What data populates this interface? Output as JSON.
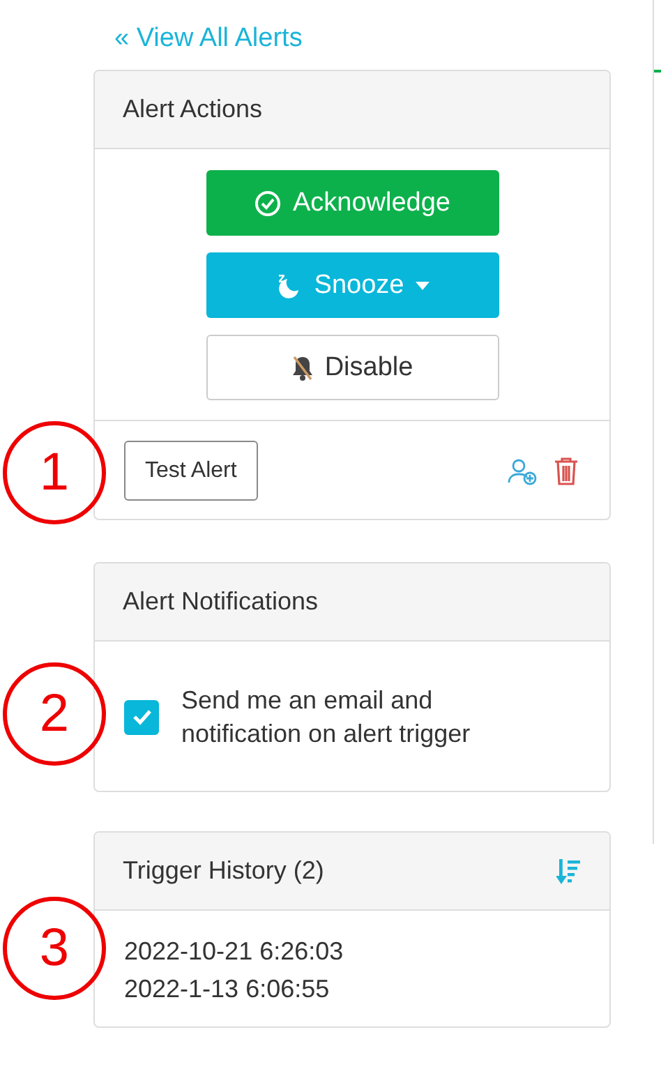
{
  "back_link": "« View All Alerts",
  "alert_actions": {
    "title": "Alert Actions",
    "buttons": [
      {
        "kind": "success",
        "label": "Acknowledge",
        "dropdown": false
      },
      {
        "kind": "info",
        "label": "Snooze",
        "dropdown": true
      },
      {
        "kind": "default",
        "label": "Disable",
        "dropdown": false
      }
    ],
    "test_button": "Test Alert"
  },
  "alert_notifications": {
    "title": "Alert Notifications",
    "checkbox": {
      "label": "Send me an email and notification on alert trigger",
      "checked": true
    }
  },
  "trigger_history": {
    "title": "Trigger History (2)",
    "entries": [
      "2022-10-21 6:26:03",
      "2022-1-13 6:06:55"
    ]
  },
  "callouts": [
    "1",
    "2",
    "3"
  ]
}
